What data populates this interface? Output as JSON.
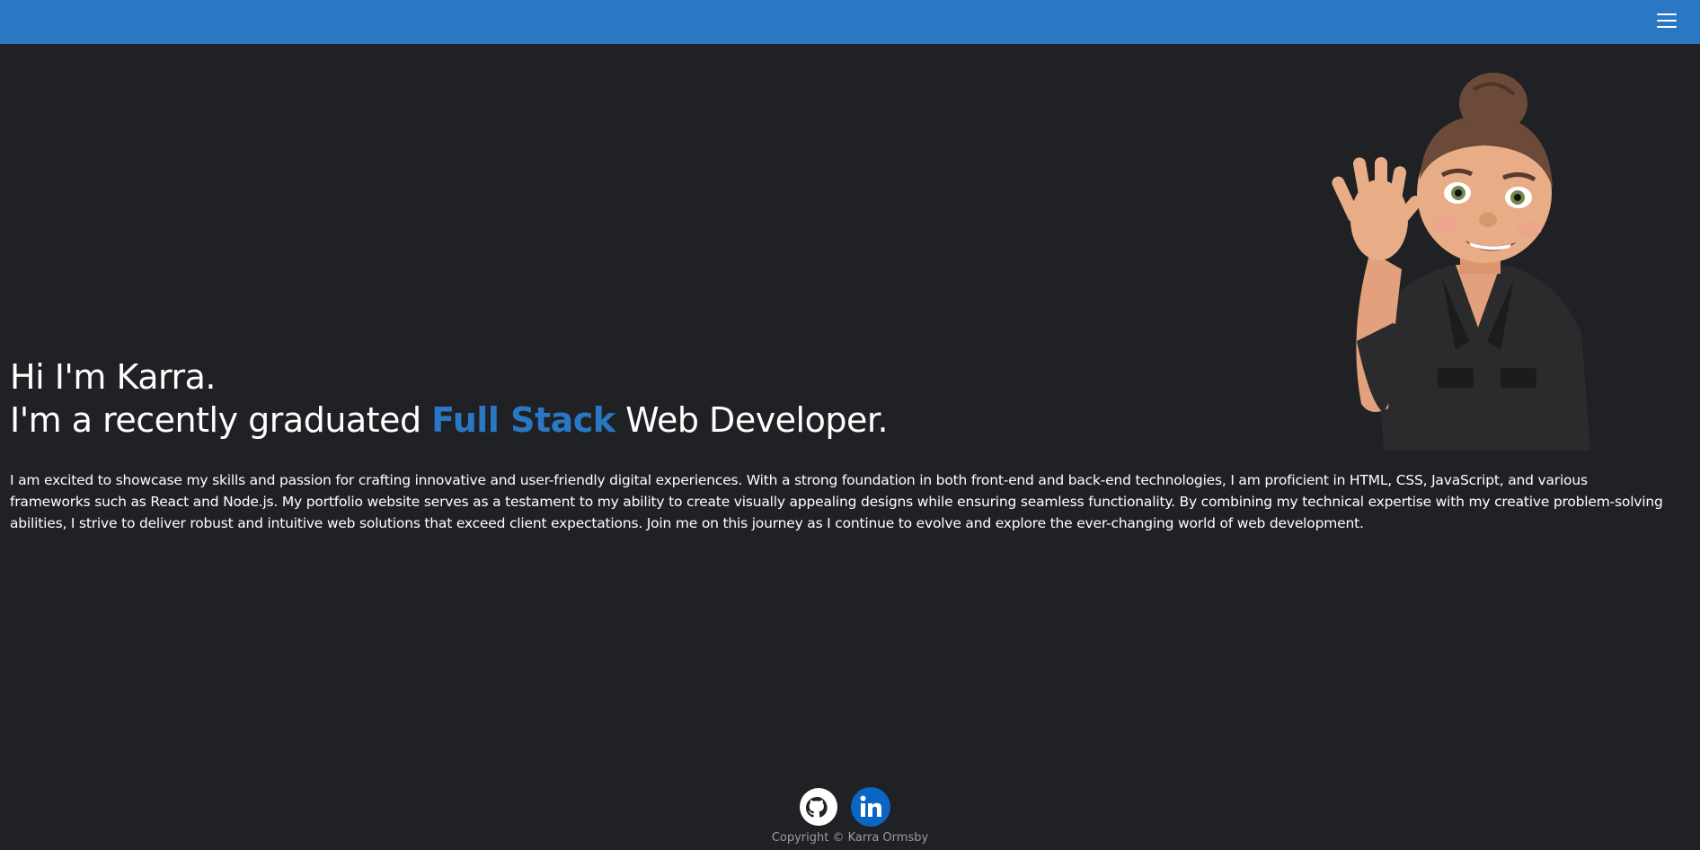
{
  "navbar": {
    "menu_icon": "hamburger-menu-icon",
    "color": "#2a78c4"
  },
  "hero": {
    "greeting": "Hi I'm Karra.",
    "headline_prefix": "I'm a recently graduated ",
    "headline_highlight": "Full Stack",
    "headline_suffix": " Web Developer.",
    "highlight_color": "#2a78c4",
    "avatar_icon": "waving-memoji-avatar"
  },
  "intro": {
    "text": "I am excited to showcase my skills and passion for crafting innovative and user-friendly digital experiences. With a strong foundation in both front-end and back-end technologies, I am proficient in HTML, CSS, JavaScript, and various frameworks such as React and Node.js. My portfolio website serves as a testament to my ability to create visually appealing designs while ensuring seamless functionality. By combining my technical expertise with my creative problem-solving abilities, I strive to deliver robust and intuitive web solutions that exceed client expectations. Join me on this journey as I continue to evolve and explore the ever-changing world of web development."
  },
  "footer": {
    "social": [
      {
        "icon": "github-icon"
      },
      {
        "icon": "linkedin-icon",
        "color": "#0a66c2"
      }
    ],
    "copyright": "Copyright © Karra Ormsby"
  },
  "colors": {
    "background": "#1f2124",
    "accent": "#2a78c4"
  }
}
